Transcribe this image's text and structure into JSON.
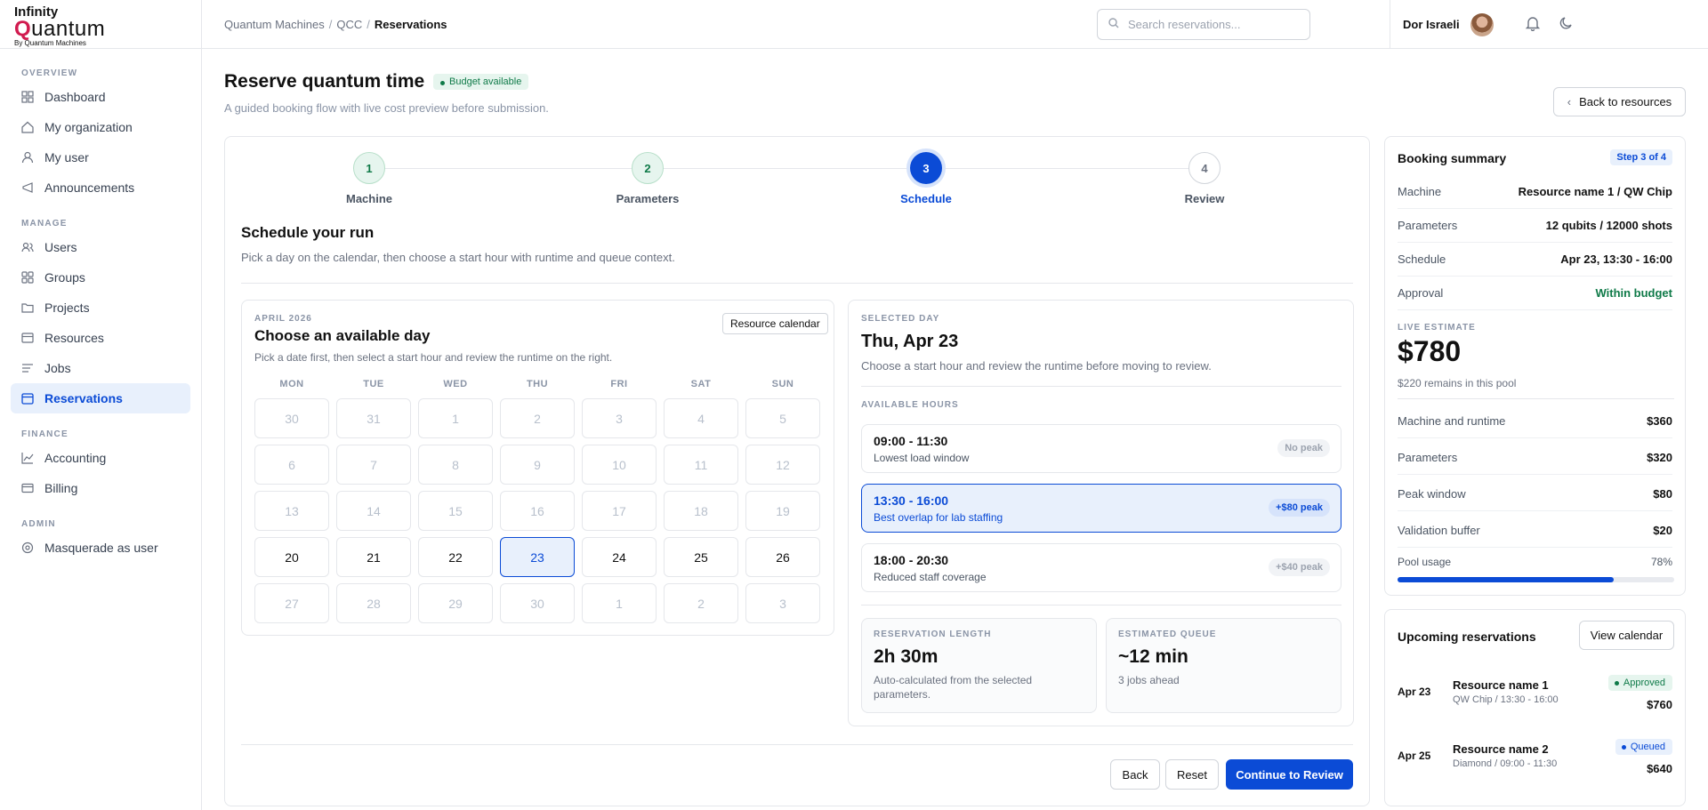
{
  "logo": {
    "line1": "Infinity",
    "line2_q": "Q",
    "line2_rest": "uantum",
    "line3": "By Quantum Machines"
  },
  "sidebar": {
    "sections": [
      {
        "title": "OVERVIEW",
        "items": [
          {
            "label": "Dashboard",
            "icon": "dashboard-icon"
          },
          {
            "label": "My organization",
            "icon": "home-icon"
          },
          {
            "label": "My user",
            "icon": "user-icon"
          },
          {
            "label": "Announcements",
            "icon": "megaphone-icon"
          }
        ]
      },
      {
        "title": "MANAGE",
        "items": [
          {
            "label": "Users",
            "icon": "users-icon"
          },
          {
            "label": "Groups",
            "icon": "groups-icon"
          },
          {
            "label": "Projects",
            "icon": "folder-icon"
          },
          {
            "label": "Resources",
            "icon": "resources-icon"
          },
          {
            "label": "Jobs",
            "icon": "list-icon"
          },
          {
            "label": "Reservations",
            "icon": "calendar-icon",
            "active": true
          }
        ]
      },
      {
        "title": "FINANCE",
        "items": [
          {
            "label": "Accounting",
            "icon": "chart-icon"
          },
          {
            "label": "Billing",
            "icon": "card-icon"
          }
        ]
      },
      {
        "title": "ADMIN",
        "items": [
          {
            "label": "Masquerade as user",
            "icon": "eye-icon"
          }
        ]
      }
    ]
  },
  "topbar": {
    "breadcrumb": [
      "Quantum Machines",
      "QCC",
      "Reservations"
    ],
    "search_placeholder": "Search reservations...",
    "user_name": "Dor Israeli"
  },
  "page": {
    "title": "Reserve quantum time",
    "budget_badge": "Budget available",
    "subtitle": "A guided booking flow with live cost preview before submission.",
    "back_button": "Back to resources"
  },
  "steps": [
    {
      "num": "1",
      "label": "Machine",
      "state": "done"
    },
    {
      "num": "2",
      "label": "Parameters",
      "state": "done"
    },
    {
      "num": "3",
      "label": "Schedule",
      "state": "current"
    },
    {
      "num": "4",
      "label": "Review",
      "state": "todo"
    }
  ],
  "schedule": {
    "title": "Schedule your run",
    "subtitle": "Pick a day on the calendar, then choose a start hour with runtime and queue context."
  },
  "calendar": {
    "month": "APRIL 2026",
    "title": "Choose an available day",
    "subtitle": "Pick a date first, then select a start hour and review the runtime on the right.",
    "resource_button": "Resource calendar",
    "weekdays": [
      "MON",
      "TUE",
      "WED",
      "THU",
      "FRI",
      "SAT",
      "SUN"
    ],
    "weeks": [
      [
        {
          "d": "30"
        },
        {
          "d": "31"
        },
        {
          "d": "1"
        },
        {
          "d": "2"
        },
        {
          "d": "3"
        },
        {
          "d": "4"
        },
        {
          "d": "5"
        }
      ],
      [
        {
          "d": "6"
        },
        {
          "d": "7"
        },
        {
          "d": "8"
        },
        {
          "d": "9"
        },
        {
          "d": "10"
        },
        {
          "d": "11"
        },
        {
          "d": "12"
        }
      ],
      [
        {
          "d": "13"
        },
        {
          "d": "14"
        },
        {
          "d": "15"
        },
        {
          "d": "16"
        },
        {
          "d": "17"
        },
        {
          "d": "18"
        },
        {
          "d": "19"
        }
      ],
      [
        {
          "d": "20",
          "a": 1
        },
        {
          "d": "21",
          "a": 1
        },
        {
          "d": "22",
          "a": 1
        },
        {
          "d": "23",
          "a": 1,
          "s": 1
        },
        {
          "d": "24",
          "a": 1
        },
        {
          "d": "25",
          "a": 1
        },
        {
          "d": "26",
          "a": 1
        }
      ],
      [
        {
          "d": "27"
        },
        {
          "d": "28"
        },
        {
          "d": "29"
        },
        {
          "d": "30"
        },
        {
          "d": "1"
        },
        {
          "d": "2"
        },
        {
          "d": "3"
        }
      ]
    ]
  },
  "selected_day": {
    "cap": "SELECTED DAY",
    "title": "Thu, Apr 23",
    "subtitle": "Choose a start hour and review the runtime before moving to review.",
    "hours_cap": "AVAILABLE HOURS",
    "slots": [
      {
        "time": "09:00 - 11:30",
        "desc": "Lowest load window",
        "tag": "No peak",
        "selected": false
      },
      {
        "time": "13:30 - 16:00",
        "desc": "Best overlap for lab staffing",
        "tag": "+$80 peak",
        "selected": true
      },
      {
        "time": "18:00 - 20:30",
        "desc": "Reduced staff coverage",
        "tag": "+$40 peak",
        "selected": false
      }
    ],
    "length": {
      "cap": "RESERVATION LENGTH",
      "value": "2h 30m",
      "note": "Auto-calculated from the selected parameters."
    },
    "queue": {
      "cap": "ESTIMATED QUEUE",
      "value": "~12 min",
      "note": "3 jobs ahead"
    }
  },
  "actions": {
    "back": "Back",
    "reset": "Reset",
    "continue": "Continue to Review"
  },
  "summary": {
    "title": "Booking summary",
    "step_badge": "Step 3 of 4",
    "rows": [
      {
        "k": "Machine",
        "v": "Resource name 1 / QW Chip"
      },
      {
        "k": "Parameters",
        "v": "12 qubits / 12000 shots"
      },
      {
        "k": "Schedule",
        "v": "Apr 23, 13:30 - 16:00"
      },
      {
        "k": "Approval",
        "v": "Within budget",
        "green": true
      }
    ],
    "estimate_cap": "LIVE ESTIMATE",
    "estimate": "$780",
    "remains": "$220 remains in this pool",
    "costs": [
      {
        "k": "Machine and runtime",
        "v": "$360"
      },
      {
        "k": "Parameters",
        "v": "$320"
      },
      {
        "k": "Peak window",
        "v": "$80"
      },
      {
        "k": "Validation buffer",
        "v": "$20"
      }
    ],
    "pool_label": "Pool usage",
    "pool_value": "78%",
    "pool_fraction": 0.78
  },
  "upcoming": {
    "title": "Upcoming reservations",
    "button": "View calendar",
    "items": [
      {
        "date": "Apr 23",
        "name": "Resource name 1",
        "sub": "QW Chip / 13:30 - 16:00",
        "status": "Approved",
        "price": "$760"
      },
      {
        "date": "Apr 25",
        "name": "Resource name 2",
        "sub": "Diamond / 09:00 - 11:30",
        "status": "Queued",
        "price": "$640"
      }
    ]
  },
  "colors": {
    "accent": "#0b4bd6",
    "success": "#0f7a48",
    "brand": "#d11b4f"
  }
}
